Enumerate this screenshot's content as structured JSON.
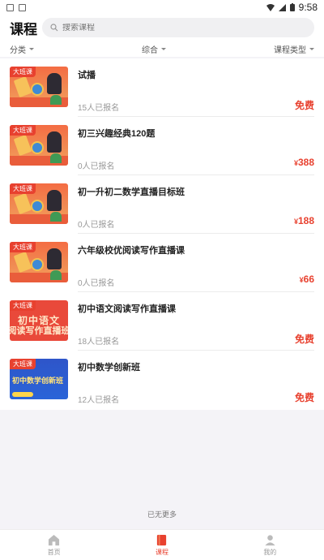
{
  "status_bar": {
    "time": "9:58"
  },
  "header": {
    "title": "课程",
    "search_placeholder": "搜索课程"
  },
  "filters": [
    {
      "label": "分类"
    },
    {
      "label": "综合"
    },
    {
      "label": "课程类型"
    }
  ],
  "courses": [
    {
      "title": "试播",
      "enrolled": "15人已报名",
      "price": "免费",
      "badge": "大班课",
      "thumb": "illustration"
    },
    {
      "title": "初三兴趣经典120题",
      "enrolled": "0人已报名",
      "price": "388",
      "badge": "大班课",
      "thumb": "illustration"
    },
    {
      "title": "初一升初二数学直播目标班",
      "enrolled": "0人已报名",
      "price": "188",
      "badge": "大班课",
      "thumb": "illustration"
    },
    {
      "title": "六年级校优阅读写作直播课",
      "enrolled": "0人已报名",
      "price": "66",
      "badge": "大班课",
      "thumb": "illustration"
    },
    {
      "title": "初中语文阅读写作直播课",
      "enrolled": "18人已报名",
      "price": "免费",
      "badge": "大班课",
      "thumb": "chinese",
      "thumb_text_1": "初中语文",
      "thumb_text_2": "阅读写作直播班"
    },
    {
      "title": "初中数学创新班",
      "enrolled": "12人已报名",
      "price": "免费",
      "badge": "大班课",
      "thumb": "math",
      "thumb_text_1": "初中数学创新班"
    }
  ],
  "currency_symbol": "¥",
  "no_more_text": "已无更多",
  "tabbar": [
    {
      "label": "首页",
      "icon": "home-icon"
    },
    {
      "label": "课程",
      "icon": "book-icon",
      "active": true
    },
    {
      "label": "我的",
      "icon": "user-icon"
    }
  ],
  "colors": {
    "accent": "#e8412f",
    "background": "#f4f3f7"
  }
}
